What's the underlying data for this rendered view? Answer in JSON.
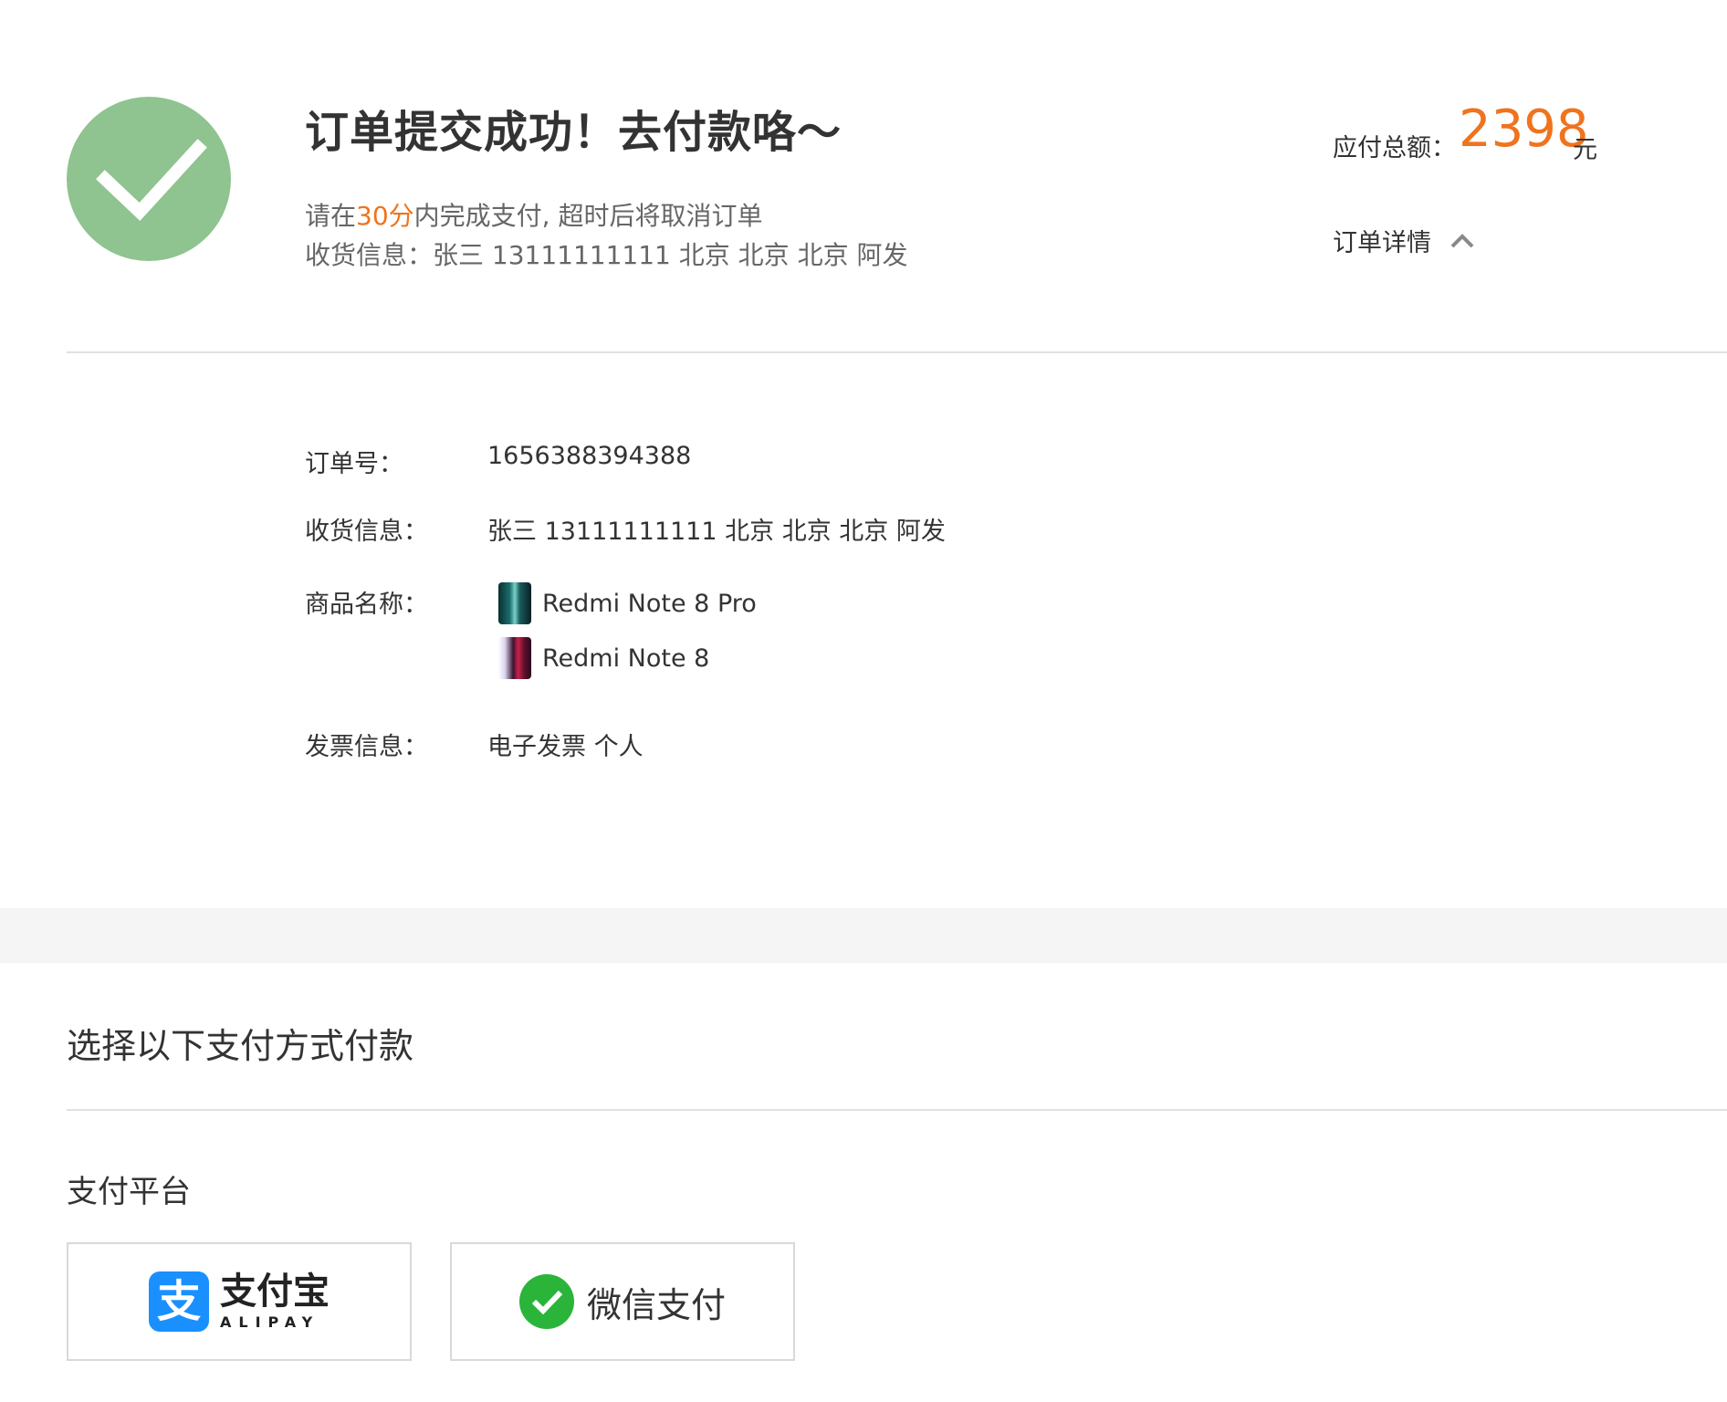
{
  "header": {
    "title": "订单提交成功！去付款咯～",
    "notice_prefix": "请在",
    "notice_time": "30分",
    "notice_suffix": "内完成支付, 超时后将取消订单",
    "shipping_label": "收货信息：",
    "shipping_value": "张三 13111111111 北京 北京 北京 阿发"
  },
  "summary": {
    "total_label": "应付总额：",
    "total_amount": "2398",
    "total_unit": "元",
    "detail_toggle_label": "订单详情"
  },
  "details": {
    "order_no_label": "订单号：",
    "order_no_value": "1656388394388",
    "shipping_label": "收货信息：",
    "shipping_value": "张三 13111111111 北京 北京 北京 阿发",
    "product_label": "商品名称：",
    "products": [
      "Redmi Note 8 Pro",
      "Redmi Note 8"
    ],
    "invoice_label": "发票信息：",
    "invoice_value": "电子发票 个人"
  },
  "payment": {
    "section_title": "选择以下支付方式付款",
    "platform_title": "支付平台",
    "alipay": {
      "icon_char": "支",
      "cn": "支付宝",
      "en": "ALIPAY"
    },
    "wechat": {
      "label": "微信支付"
    }
  },
  "colors": {
    "accent": "#f0731d",
    "success": "#8fc38f",
    "alipay_blue": "#1a90ff",
    "wechat_green": "#2ab53a"
  },
  "icons": {
    "success": "checkmark-icon",
    "toggle": "chevron-up-icon"
  }
}
